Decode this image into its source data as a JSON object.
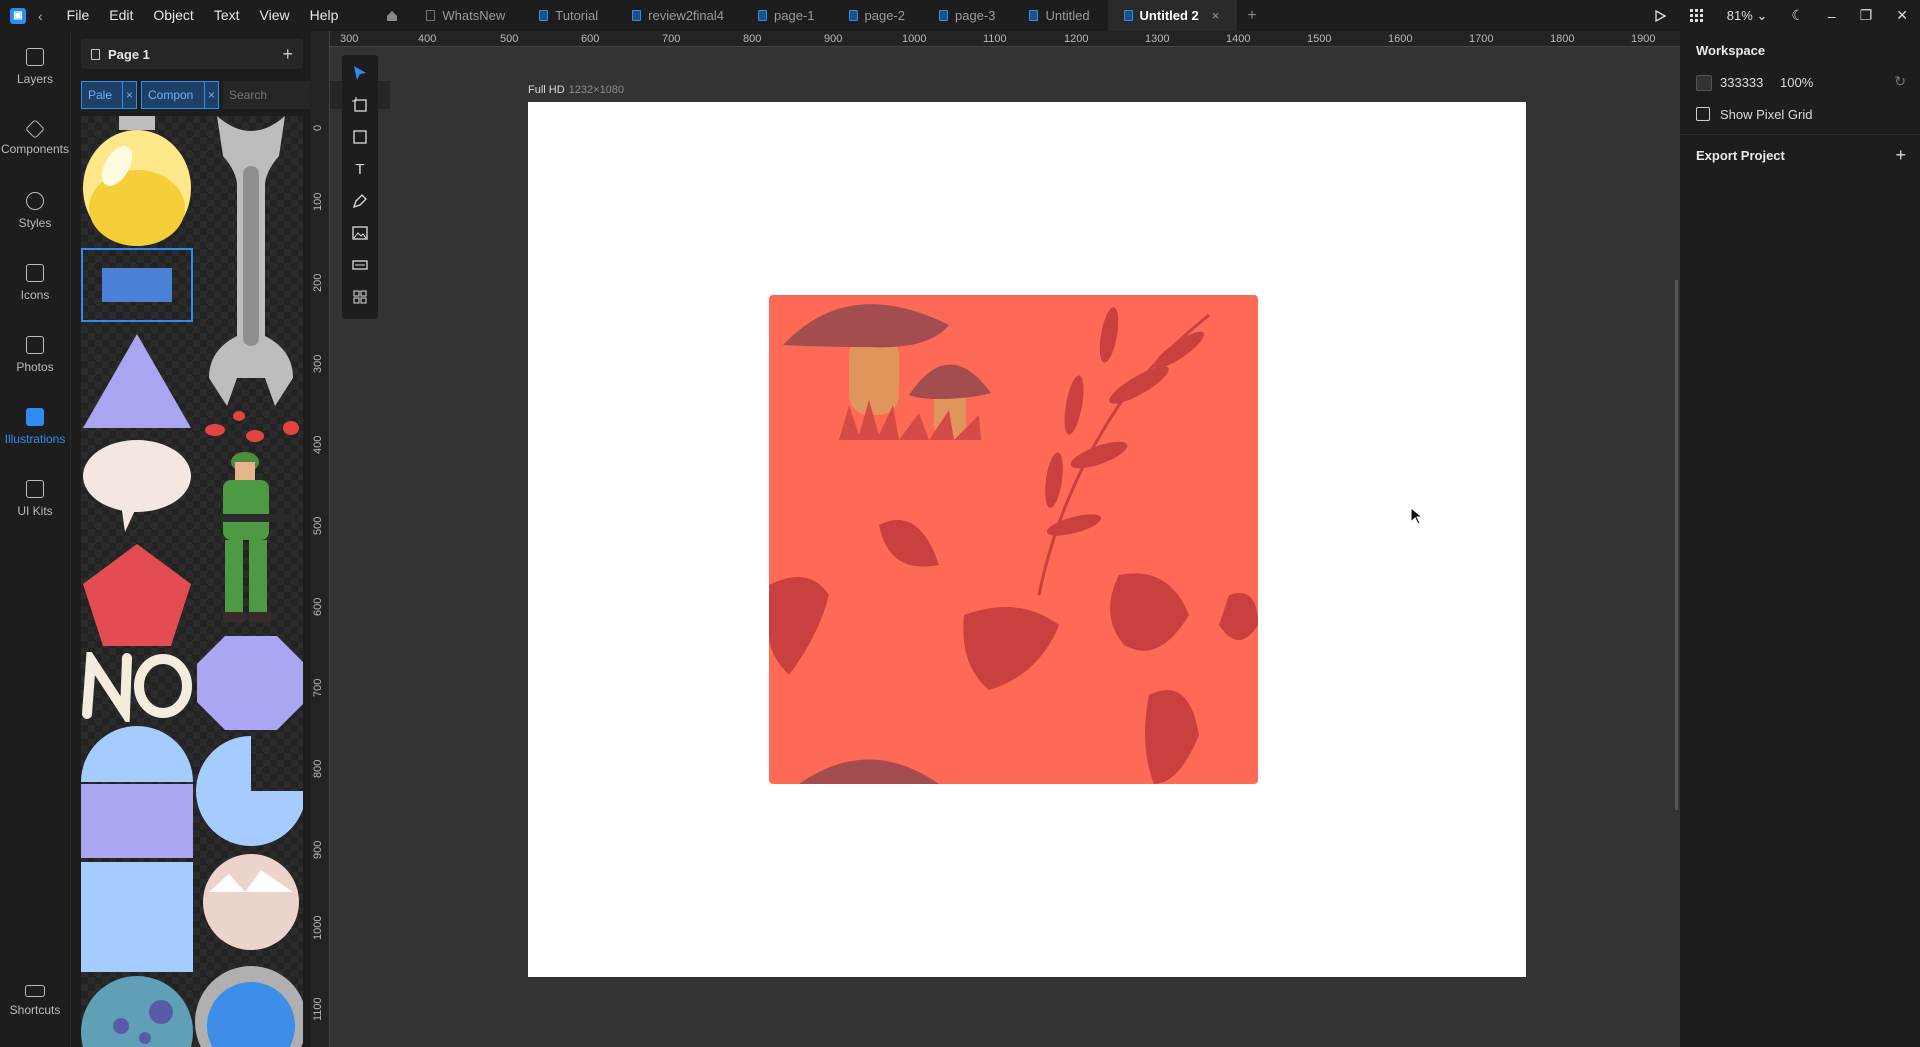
{
  "menu": [
    "File",
    "Edit",
    "Object",
    "Text",
    "View",
    "Help"
  ],
  "tabs": [
    {
      "label": "WhatsNew",
      "kind": "doc",
      "active": false
    },
    {
      "label": "Tutorial",
      "kind": "shared",
      "active": false
    },
    {
      "label": "review2final4",
      "kind": "shared",
      "active": false
    },
    {
      "label": "page-1",
      "kind": "shared",
      "active": false
    },
    {
      "label": "page-2",
      "kind": "shared",
      "active": false
    },
    {
      "label": "page-3",
      "kind": "shared",
      "active": false
    },
    {
      "label": "Untitled",
      "kind": "shared",
      "active": false
    },
    {
      "label": "Untitled 2",
      "kind": "shared",
      "active": true
    }
  ],
  "zoom": "81%",
  "rail": [
    {
      "label": "Layers",
      "icon": "layers-icon",
      "active": false
    },
    {
      "label": "Components",
      "icon": "components-icon",
      "active": false
    },
    {
      "label": "Styles",
      "icon": "styles-icon",
      "active": false
    },
    {
      "label": "Icons",
      "icon": "icons-icon",
      "active": false
    },
    {
      "label": "Photos",
      "icon": "photos-icon",
      "active": false
    },
    {
      "label": "Illustrations",
      "icon": "illustrations-icon",
      "active": true
    },
    {
      "label": "UI Kits",
      "icon": "ui-kits-icon",
      "active": false
    }
  ],
  "rail_bottom": {
    "label": "Shortcuts"
  },
  "assets": {
    "page_label": "Page 1",
    "filters": [
      "Pale",
      "Compon"
    ],
    "search_placeholder": "Search"
  },
  "ruler": {
    "top": [
      "300",
      "400",
      "500",
      "600",
      "700",
      "800",
      "900",
      "1000",
      "1100",
      "1200",
      "1300",
      "1400",
      "1500",
      "1600",
      "1700",
      "1800",
      "1900"
    ],
    "left": [
      "0",
      "100",
      "200",
      "300",
      "400",
      "500",
      "600",
      "700",
      "800",
      "900",
      "1000",
      "1100"
    ]
  },
  "canvas": {
    "frame_name": "Full HD",
    "frame_size": "1232×1080",
    "frame_color": "#ffffff",
    "art_color": "#ff6a57"
  },
  "right_panel": {
    "workspace_title": "Workspace",
    "bg_hex": "333333",
    "bg_opacity": "100%",
    "pixel_grid_label": "Show Pixel Grid",
    "export_title": "Export Project"
  },
  "colors": {
    "accent": "#2f8cf0",
    "chrome": "#1d1d1d",
    "workspace": "#333333"
  }
}
